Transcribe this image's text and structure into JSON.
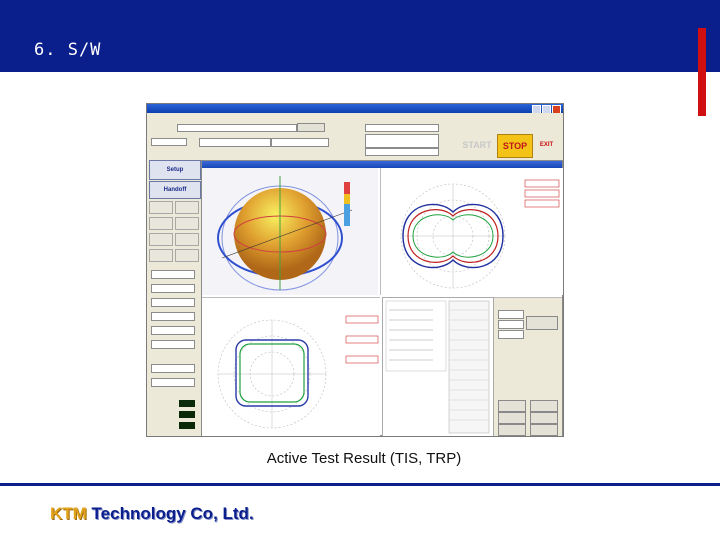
{
  "slide": {
    "title": "6. S/W",
    "caption": "Active Test Result (TIS, TRP)",
    "company_brand": "KTM",
    "company_rest": " Technology Co, Ltd."
  },
  "screenshot": {
    "start_label": "START",
    "stop_label": "STOP",
    "exit_label": "EXIT",
    "setup_label": "Setup",
    "handoff_label": "Handoff",
    "colors": {
      "title_bar": "#0a1e8c",
      "accent_red": "#d01010",
      "stop_bg": "#f3c318",
      "brand_gold": "#e2a21a"
    }
  }
}
